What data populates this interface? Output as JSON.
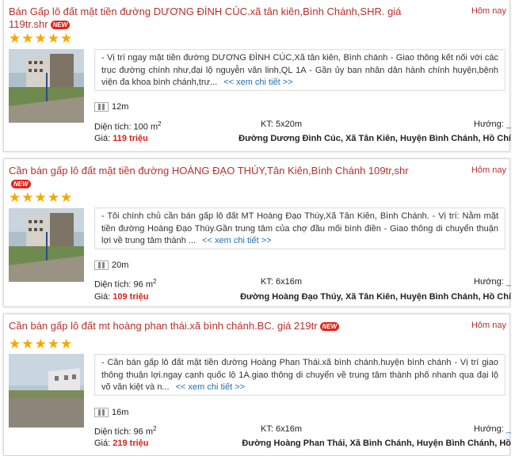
{
  "listings": [
    {
      "title": "Bán Gấp lô đất mặt tiền đường DƯƠNG ĐÌNH CÚC.xã tân kiên,Bình Chánh,SHR. giá 119tr.shr",
      "badge": "NEW",
      "date": "Hôm nay",
      "stars": "★★★★★",
      "description": "- Vị trí ngay mặt tiền đường DƯƠNG ĐÌNH CÚC,Xã tân kiên, Bình chánh - Giao thông kết nối với các trục đường chính như,đại lộ nguyễn văn linh,QL 1A - Gần ủy ban nhân dân hành chính huyện,bệnh viện đa khoa bình chánh,trư...",
      "more": "<< xem chi tiết >>",
      "road_width": "12m",
      "area_label": "Diện tích:",
      "area_value": "100 m",
      "area_sup": "2",
      "size_label": "KT:",
      "size_value": "5x20m",
      "direction_label": "Hướng:",
      "direction_value": "_",
      "price_label": "Giá:",
      "price_value": "119 triệu",
      "address": "Đường Dương Đình Cúc, Xã Tân Kiên, Huyện Bình Chánh, Hồ Chí"
    },
    {
      "title": "Cần bán gấp lô đất mặt tiền đường HOÀNG ĐẠO THÚY,Tân Kiên,Bình Chánh 109tr,shr",
      "badge": "NEW",
      "date": "Hôm nay",
      "stars": "★★★★★",
      "description": "- Tôi chính chủ cần bán gấp lô đất MT Hoàng Đạo Thúy,Xã Tân Kiên, Bình Chánh. - Vị trí: Nằm mặt tiền đường Hoàng Đạo Thúy.Gần trung tâm của chợ đầu mối bình điền - Giao thông di chuyển thuận lợi về trung tâm thành ...",
      "more": "<< xem chi tiết >>",
      "road_width": "20m",
      "area_label": "Diện tích:",
      "area_value": "96 m",
      "area_sup": "2",
      "size_label": "KT:",
      "size_value": "6x16m",
      "direction_label": "Hướng:",
      "direction_value": "_",
      "price_label": "Giá:",
      "price_value": "109 triệu",
      "address": "Đường Hoàng Đạo Thúy, Xã Tân Kiên, Huyện Bình Chánh, Hồ Chí"
    },
    {
      "title": "Cần bán gấp lô đất mt hoàng phan thái.xã bình chánh.BC. giá 219tr",
      "badge": "NEW",
      "date": "Hôm nay",
      "stars": "★★★★★",
      "description": "- Cần bán gấp lô đất mặt tiền đường Hoàng Phan Thái.xã bình chánh.huyện bình chánh - Vị trí giao thông thuận lợi.ngay cạnh quốc lộ 1A.giao thông di chuyển về trung tâm thành phố nhanh qua đại lộ võ văn kiệt và n...",
      "more": "<< xem chi tiết >>",
      "road_width": "16m",
      "area_label": "Diện tích:",
      "area_value": "96 m",
      "area_sup": "2",
      "size_label": "KT:",
      "size_value": "6x16m",
      "direction_label": "Hướng:",
      "direction_value": "_",
      "price_label": "Giá:",
      "price_value": "219 triệu",
      "address": "Đường Hoàng Phan Thái, Xã Bình Chánh, Huyện Bình Chánh, Hồ"
    }
  ],
  "colors": {
    "title": "#b7302c",
    "price": "#d6231c",
    "link": "#1f6fb5",
    "stars": "#f5a800"
  }
}
